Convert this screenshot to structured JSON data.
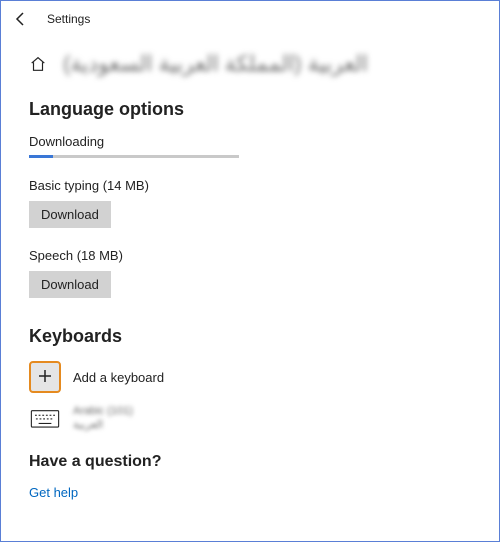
{
  "topbar": {
    "title": "Settings"
  },
  "header": {
    "language_title": "العربية (المملكة العربية السعودية)"
  },
  "language_options": {
    "heading": "Language options",
    "downloading_label": "Downloading",
    "features": [
      {
        "label": "Basic typing (14 MB)",
        "button": "Download"
      },
      {
        "label": "Speech (18 MB)",
        "button": "Download"
      }
    ]
  },
  "keyboards": {
    "heading": "Keyboards",
    "add_label": "Add a keyboard",
    "items": [
      {
        "name": "Arabic (101)",
        "sub": "العربية"
      }
    ]
  },
  "question": {
    "heading": "Have a question?",
    "link": "Get help"
  }
}
